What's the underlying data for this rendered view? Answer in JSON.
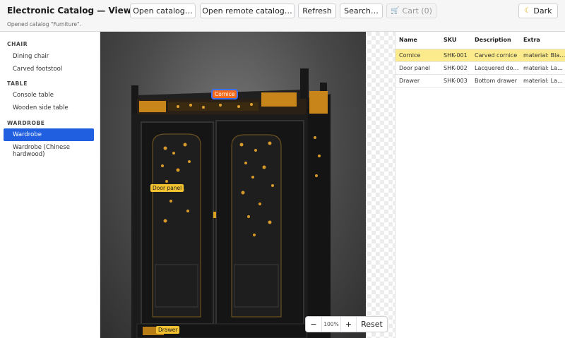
{
  "app": {
    "title": "Electronic Catalog — Viewer",
    "status": "Opened catalog \"Furniture\"."
  },
  "toolbar": {
    "open_catalog": "Open catalog…",
    "open_remote": "Open remote catalog…",
    "refresh": "Refresh",
    "search": "Search…",
    "cart_icon": "cart-icon",
    "cart": "Cart (0)",
    "theme_icon": "moon-icon",
    "theme": "Dark"
  },
  "sidebar": {
    "categories": [
      {
        "name": "CHAIR",
        "items": [
          "Dining chair",
          "Carved footstool"
        ]
      },
      {
        "name": "TABLE",
        "items": [
          "Console table",
          "Wooden side table"
        ]
      },
      {
        "name": "WARDROBE",
        "items": [
          "Wardrobe",
          "Wardrobe (Chinese hardwood)"
        ]
      }
    ],
    "selected": "Wardrobe"
  },
  "viewer": {
    "hotspots": {
      "cornice": "Cornice",
      "door_panel": "Door panel",
      "drawer": "Drawer"
    },
    "zoom": {
      "out": "−",
      "level": "100%",
      "in": "+",
      "reset": "Reset"
    }
  },
  "parts_table": {
    "columns": [
      "Name",
      "SKU",
      "Description",
      "Extra"
    ],
    "rows": [
      [
        "Cornice",
        "SHK-001",
        "Carved cornice",
        "material: Black lacquer"
      ],
      [
        "Door panel",
        "SHK-002",
        "Lacquered door panel",
        "material: Lacquer"
      ],
      [
        "Drawer",
        "SHK-003",
        "Bottom drawer",
        "material: Lacquer"
      ]
    ],
    "selected_row": 0
  }
}
